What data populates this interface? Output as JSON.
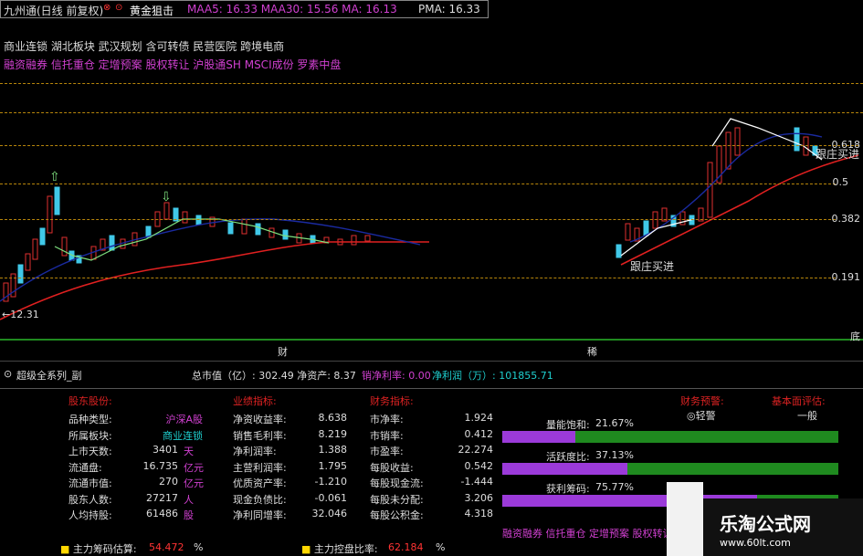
{
  "header": {
    "title": "九州通(日线 前复权)",
    "signal": "黄金狙击",
    "ma_values": "MAA5: 16.33  MAA30: 15.56  MA: 16.13",
    "pma": "PMA: 16.33"
  },
  "concept_tags": {
    "line1": "商业连锁 湖北板块 武汉规划 含可转债 民营医院 跨境电商",
    "line2": "融资融券 信托重仓 定增预案 股权转让 沪股通SH MSCI成份 罗素中盘"
  },
  "chart": {
    "levels": [
      "0.618",
      "0.5",
      "0.382",
      "0.191",
      "底"
    ],
    "low_label": "←12.31",
    "annotations": [
      "跟庄买进",
      "跟庄买进"
    ],
    "marks": [
      "财",
      "稀"
    ]
  },
  "sub_bar": {
    "title": "超级全系列_副",
    "stats": "总市值（亿）: 302.49  净资产: 8.37",
    "net_margin": "销净利率: 0.00",
    "net_profit": "净利润（万）: 101855.71"
  },
  "panel": {
    "col_headers": [
      "股东股份:",
      "业绩指标:",
      "财务指标:",
      "财务预警:",
      "基本面评估:"
    ],
    "warning_value": "◎轻警",
    "rating_value": "一般",
    "share_rows": [
      {
        "label": "品种类型:",
        "value": "沪深A股",
        "unit": ""
      },
      {
        "label": "所属板块:",
        "value": "商业连锁",
        "unit": ""
      },
      {
        "label": "上市天数:",
        "value": "3401",
        "unit": "天"
      },
      {
        "label": "流通盘:",
        "value": "16.735",
        "unit": "亿元"
      },
      {
        "label": "流通市值:",
        "value": "270",
        "unit": "亿元"
      },
      {
        "label": "股东人数:",
        "value": "27217",
        "unit": "人"
      },
      {
        "label": "人均持股:",
        "value": "61486",
        "unit": "股"
      }
    ],
    "perf_rows": [
      {
        "label": "净资收益率:",
        "value": "8.638"
      },
      {
        "label": "销售毛利率:",
        "value": "8.219"
      },
      {
        "label": "净利润率:",
        "value": "1.388"
      },
      {
        "label": "主营利润率:",
        "value": "1.795"
      },
      {
        "label": "优质资产率:",
        "value": "-1.210"
      },
      {
        "label": "现金负债比:",
        "value": "-0.061"
      },
      {
        "label": "净利同增率:",
        "value": "32.046"
      }
    ],
    "fin_rows": [
      {
        "label": "市净率:",
        "value": "1.924"
      },
      {
        "label": "市销率:",
        "value": "0.412"
      },
      {
        "label": "市盈率:",
        "value": "22.274"
      },
      {
        "label": "每股收益:",
        "value": "0.542"
      },
      {
        "label": "每股现金流:",
        "value": "-1.444"
      },
      {
        "label": "每股未分配:",
        "value": "3.206"
      },
      {
        "label": "每股公积金:",
        "value": "4.318"
      }
    ],
    "bars": [
      {
        "label": "量能饱和:",
        "value": "21.67%",
        "fraction": 0.2167
      },
      {
        "label": "活跃度比:",
        "value": "37.13%",
        "fraction": 0.3713
      },
      {
        "label": "获利筹码:",
        "value": "75.77%",
        "fraction": 0.7577
      }
    ],
    "footer_tags": "融资融券 信托重仓 定增预案 股权转让",
    "chip_estimate_label": "主力筹码估算:",
    "chip_estimate_value": "54.472",
    "control_label": "主力控盘比率:",
    "control_value": "62.184",
    "percent_sign": "%"
  },
  "watermark": {
    "brand": "乐淘公式网",
    "url": "www.60lt.com"
  },
  "colors": {
    "ma_line": "#e02020",
    "ma_dark": "#1a2aa0",
    "up_candle": "#e03030",
    "down_candle": "#40c8e8",
    "panel_header": "#d02020",
    "bar_green": "#1f8a1f",
    "bar_purple": "#9b3ad9"
  }
}
